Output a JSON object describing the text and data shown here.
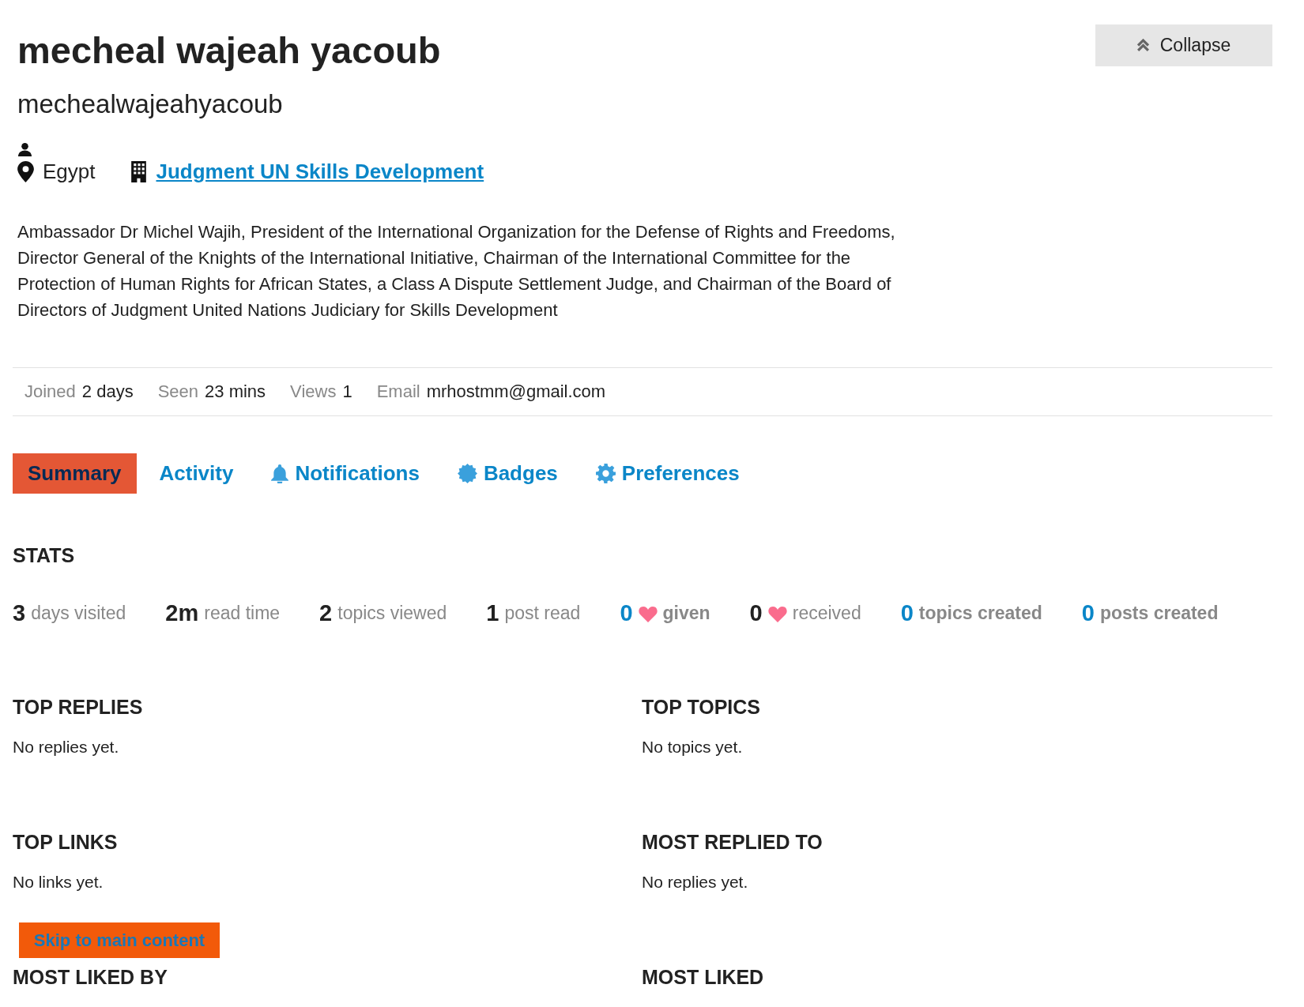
{
  "profile": {
    "name": "mecheal wajeah yacoub",
    "username": "mechealwajeahyacoub",
    "location": "Egypt",
    "website": "Judgment UN Skills Development",
    "bio": "Ambassador Dr Michel Wajih, President of the International Organization for the Defense of Rights and Freedoms, Director General of the Knights of the International Initiative, Chairman of the International Committee for the Protection of Human Rights for African States, a Class A Dispute Settlement Judge, and Chairman of the Board of Directors of Judgment United Nations Judiciary for Skills Development"
  },
  "collapse_button": {
    "label": "Collapse"
  },
  "meta": [
    {
      "label": "Joined",
      "value": "2 days"
    },
    {
      "label": "Seen",
      "value": "23 mins"
    },
    {
      "label": "Views",
      "value": "1"
    },
    {
      "label": "Email",
      "value": "mrhostmm@gmail.com"
    }
  ],
  "tabs": [
    {
      "label": "Summary",
      "kind": "summary",
      "selected": true
    },
    {
      "label": "Activity",
      "kind": "activity",
      "selected": false
    },
    {
      "label": "Notifications",
      "kind": "notifications",
      "selected": false
    },
    {
      "label": "Badges",
      "kind": "badges",
      "selected": false
    },
    {
      "label": "Preferences",
      "kind": "preferences",
      "selected": false
    }
  ],
  "stats": {
    "title": "STATS",
    "items": [
      {
        "value": "3",
        "label": "days visited",
        "kind": "count"
      },
      {
        "value": "2m",
        "label": "read time",
        "kind": "count"
      },
      {
        "value": "2",
        "label": "topics viewed",
        "kind": "count"
      },
      {
        "value": "1",
        "label": "post read",
        "kind": "count"
      },
      {
        "value": "0",
        "label": "given",
        "kind": "link-heart"
      },
      {
        "value": "0",
        "label": "received",
        "kind": "count-heart"
      },
      {
        "value": "0",
        "label": "topics created",
        "kind": "link"
      },
      {
        "value": "0",
        "label": "posts created",
        "kind": "link"
      }
    ]
  },
  "sections": [
    {
      "title": "TOP REPLIES",
      "text": "No replies yet."
    },
    {
      "title": "TOP TOPICS",
      "text": "No topics yet."
    },
    {
      "title": "TOP LINKS",
      "text": "No links yet."
    },
    {
      "title": "MOST REPLIED TO",
      "text": "No replies yet."
    },
    {
      "title": "MOST LIKED BY"
    },
    {
      "title": "MOST LIKED"
    }
  ],
  "skip_link": {
    "label": "Skip to main content"
  }
}
